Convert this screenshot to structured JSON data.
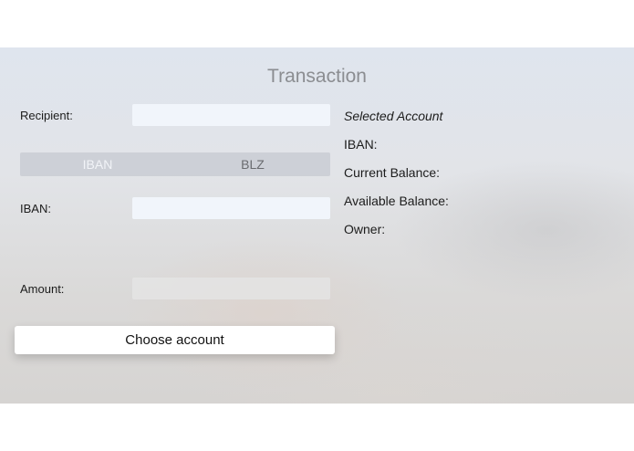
{
  "screen": {
    "title": "Transaction"
  },
  "form": {
    "recipient_label": "Recipient:",
    "recipient_value": "",
    "segments": [
      {
        "label": "IBAN",
        "selected": true
      },
      {
        "label": "BLZ",
        "selected": false
      }
    ],
    "iban_label": "IBAN:",
    "iban_value": "",
    "amount_label": "Amount:",
    "amount_value": "",
    "choose_account_label": "Choose account"
  },
  "account_panel": {
    "heading": "Selected Account",
    "iban_label": "IBAN:",
    "current_balance_label": "Current Balance:",
    "available_balance_label": "Available Balance:",
    "owner_label": "Owner:"
  }
}
